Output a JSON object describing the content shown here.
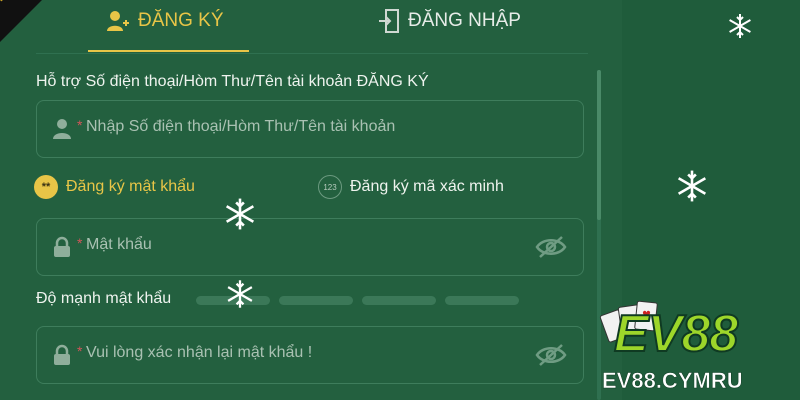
{
  "tabs": {
    "register": "ĐĂNG KÝ",
    "login": "ĐĂNG NHẬP"
  },
  "form": {
    "support_label": "Hỗ trợ Số điện thoại/Hòm Thư/Tên tài khoản ĐĂNG KÝ",
    "account_placeholder": "Nhập Số điện thoại/Hòm Thư/Tên tài khoản",
    "required_mark": "*",
    "option_password": "Đăng ký mật khẩu",
    "option_password_icon_text": "**",
    "option_code": "Đăng ký mã xác minh",
    "option_code_icon_text": "123",
    "password_placeholder": "Mật khẩu",
    "strength_label": "Độ mạnh mật khẩu",
    "confirm_placeholder": "Vui lòng xác nhận lại mật khẩu !"
  },
  "brand": {
    "logo_text": "EV88",
    "domain": "EV88.CYMRU"
  },
  "colors": {
    "accent": "#e8c547",
    "background": "#23603f",
    "required": "#d2555a",
    "logo_green": "#9dd62a"
  },
  "icons": [
    "user-add-icon",
    "login-door-icon",
    "user-icon",
    "lock-icon",
    "eye-off-icon",
    "smiley-icon",
    "code-badge-icon",
    "snowflake-icon"
  ]
}
